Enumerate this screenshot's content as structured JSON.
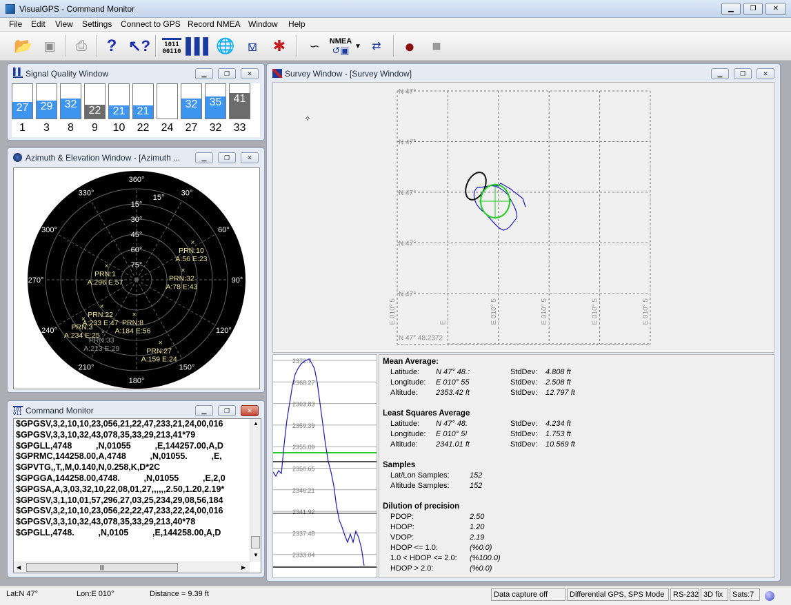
{
  "app": {
    "title": "VisualGPS - Command Monitor"
  },
  "window_controls": {
    "minimize": "▁",
    "restore": "❐",
    "close": "✕"
  },
  "menu": [
    "File",
    "Edit",
    "View",
    "Settings",
    "Connect to GPS",
    "Record NMEA",
    "Window",
    "Help"
  ],
  "toolbar": {
    "items": [
      {
        "name": "open-icon",
        "glyph": "📂"
      },
      {
        "name": "save-icon",
        "glyph": "💾"
      },
      {
        "name": "print-icon",
        "glyph": "🖨"
      },
      {
        "name": "help-icon",
        "glyph": "?"
      },
      {
        "name": "context-help-icon",
        "glyph": "↖?"
      },
      {
        "name": "command-monitor-icon",
        "glyph": "1011"
      },
      {
        "name": "signal-quality-icon",
        "glyph": "▮▮▮"
      },
      {
        "name": "azimuth-elevation-icon",
        "glyph": "🌐"
      },
      {
        "name": "survey-icon",
        "glyph": "⟁"
      },
      {
        "name": "navigation-icon",
        "glyph": "✱"
      },
      {
        "name": "satellite-connect-icon",
        "glyph": "⌇"
      },
      {
        "name": "nmea-record-icon",
        "glyph": "NMEA"
      },
      {
        "name": "disconnect-icon",
        "glyph": "✂"
      },
      {
        "name": "record-icon",
        "glyph": "●"
      },
      {
        "name": "stop-icon",
        "glyph": "■"
      }
    ],
    "nmea_label": "NMEA"
  },
  "signal_window": {
    "title": "Signal Quality Window",
    "bars": [
      {
        "prn": "1",
        "snr": "27",
        "level": 0.49,
        "color": "#3d95f0"
      },
      {
        "prn": "3",
        "snr": "29",
        "level": 0.53,
        "color": "#3d95f0"
      },
      {
        "prn": "8",
        "snr": "32",
        "level": 0.58,
        "color": "#3d95f0"
      },
      {
        "prn": "9",
        "snr": "22",
        "level": 0.4,
        "color": "#6c6c6c"
      },
      {
        "prn": "10",
        "snr": "21",
        "level": 0.38,
        "color": "#3d95f0"
      },
      {
        "prn": "22",
        "snr": "21",
        "level": 0.38,
        "color": "#3d95f0"
      },
      {
        "prn": "24",
        "snr": "",
        "level": 0,
        "color": "#3d95f0"
      },
      {
        "prn": "27",
        "snr": "32",
        "level": 0.58,
        "color": "#3d95f0"
      },
      {
        "prn": "32",
        "snr": "35",
        "level": 0.64,
        "color": "#3d95f0"
      },
      {
        "prn": "33",
        "snr": "41",
        "level": 0.75,
        "color": "#6c6c6c"
      }
    ]
  },
  "azel_window": {
    "title": "Azimuth & Elevation Window - [Azimuth ...",
    "azimuth_labels": [
      "360°",
      "15°",
      "30°",
      "60°",
      "90°",
      "120°",
      "150°",
      "180°",
      "210°",
      "240°",
      "270°",
      "300°",
      "330°"
    ],
    "elevation_labels": [
      "15°",
      "30°",
      "45°",
      "60°",
      "75°"
    ],
    "satellites": [
      {
        "prn": "PRN:10",
        "info": "A:56 E:23",
        "az": 56,
        "el": 23,
        "color": "#f3e79a"
      },
      {
        "prn": "PRN:1",
        "info": "A:296 E:57",
        "az": 296,
        "el": 57,
        "color": "#f3e79a"
      },
      {
        "prn": "PRN:32",
        "info": "A:78 E:43",
        "az": 78,
        "el": 43,
        "color": "#f3e79a"
      },
      {
        "prn": "PRN:22",
        "info": "A:233 E:47",
        "az": 233,
        "el": 47,
        "color": "#f3e79a"
      },
      {
        "prn": "PRN:8",
        "info": "A:184 E:56",
        "az": 184,
        "el": 56,
        "color": "#f3e79a"
      },
      {
        "prn": "PRN:3",
        "info": "A:234 E:25",
        "az": 234,
        "el": 25,
        "color": "#f3e79a"
      },
      {
        "prn": "PRN:33",
        "info": "A:213 E:29",
        "az": 213,
        "el": 29,
        "color": "#9a9a9a"
      },
      {
        "prn": "PRN:27",
        "info": "A:159 E:24",
        "az": 159,
        "el": 24,
        "color": "#f3e79a"
      }
    ]
  },
  "command_window": {
    "title": "Command Monitor",
    "lines": [
      "$GPGSV,3,2,10,10,23,056,21,22,47,233,21,24,00,016",
      "$GPGSV,3,3,10,32,43,078,35,33,29,213,41*79",
      "$GPGLL,4748          ,N,01055          ,E,144257.00,A,D",
      "$GPRMC,144258.00,A,4748          ,N,01055.          ,E,",
      "$GPVTG,,T,,M,0.140,N,0.258,K,D*2C",
      "$GPGGA,144258.00,4748.          ,N,01055          ,E,2,0",
      "$GPGSA,A,3,03,32,10,22,08,01,27,,,,,,2.50,1.20,2.19*",
      "$GPGSV,3,1,10,01,57,296,27,03,25,234,29,08,56,184",
      "$GPGSV,3,2,10,10,23,056,22,22,47,233,22,24,00,016",
      "$GPGSV,3,3,10,32,43,078,35,33,29,213,40*78",
      "$GPGLL,4748.          ,N,0105          ,E,144258.00,A,D"
    ]
  },
  "survey_window": {
    "title": "Survey Window - [Survey Window]",
    "lat_labels": [
      "N 47°",
      "N 47°",
      "N 47°",
      "N 47°",
      "N 47°",
      "N 47° 48.2372"
    ],
    "lon_labels": [
      "E 010° 5",
      "E",
      "E 010° 5",
      "E 010° 5",
      "E 010° 5",
      "E 010° 5"
    ],
    "alt_ticks": [
      "2372.7",
      "2368.27",
      "2363.83",
      "2359.39",
      "2355.09",
      "2350.65",
      "2346.21",
      "2341.92",
      "2337.48",
      "2333.04"
    ]
  },
  "stats": {
    "mean_header": "Mean Average:",
    "least_header": "Least Squares Average",
    "samples_header": "Samples",
    "dop_header": "Dilution of precision",
    "lat_label": "Latitude:",
    "lon_label": "Longitude:",
    "alt_label": "Altitude:",
    "stddev_label": "StdDev:",
    "mean": {
      "lat": "N 47° 48.:",
      "lon": "E 010° 55",
      "alt": "2353.42  ft",
      "sd_lat": "4.808 ft",
      "sd_lon": "2.508 ft",
      "sd_alt": "12.797 ft"
    },
    "least": {
      "lat": "N 47° 48.",
      "lon": "E 010° 5!",
      "alt": "2341.01  ft",
      "sd_lat": "4.234 ft",
      "sd_lon": "1.753 ft",
      "sd_alt": "10.569 ft"
    },
    "samples": {
      "latlon_label": "Lat/Lon Samples:",
      "latlon": "152",
      "alt_label": "Altitude Samples:",
      "alt": "152"
    },
    "dop": {
      "pdop_label": "PDOP:",
      "pdop": "2.50",
      "hdop_label": "HDOP:",
      "hdop": "1.20",
      "vdop_label": "VDOP:",
      "vdop": "2.19",
      "h1_label": "HDOP <= 1.0:",
      "h1": "(%0.0)",
      "h2_label": "1.0 < HDOP <= 2.0:",
      "h2": "(%100.0)",
      "h3_label": "HDOP > 2.0:",
      "h3": "(%0.0)"
    }
  },
  "status": {
    "lat": "Lat:N 47°",
    "lon": "Lon:E 010°",
    "distance": "Distance = 9.39 ft",
    "capture": "Data capture off",
    "mode": "Differential GPS, SPS Mode",
    "port": "RS-232",
    "fix": "3D fix",
    "sats": "Sats:7"
  }
}
